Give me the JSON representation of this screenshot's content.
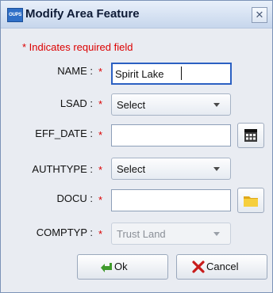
{
  "window": {
    "title": "Modify Area Feature",
    "app_icon_text": "OUPS",
    "close_glyph": "✕"
  },
  "form": {
    "required_note": "* Indicates required field",
    "required_marker": "*",
    "fields": {
      "name": {
        "label": "NAME :",
        "value": "Spirit Lake"
      },
      "lsad": {
        "label": "LSAD :",
        "selected": "Select"
      },
      "eff_date": {
        "label": "EFF_DATE :",
        "value": "",
        "button_icon": "calendar-icon"
      },
      "authtype": {
        "label": "AUTHTYPE :",
        "selected": "Select"
      },
      "docu": {
        "label": "DOCU :",
        "value": "",
        "button_icon": "folder-icon"
      },
      "comptyp": {
        "label": "COMPTYP :",
        "selected": "Trust Land",
        "disabled": true
      }
    }
  },
  "buttons": {
    "ok": {
      "label": "Ok",
      "icon": "green-arrow-icon"
    },
    "cancel": {
      "label": "Cancel",
      "icon": "red-x-icon"
    }
  },
  "colors": {
    "required": "#dc0000",
    "focus_border": "#2b60c2",
    "title_bar": "#c7d6ec"
  }
}
